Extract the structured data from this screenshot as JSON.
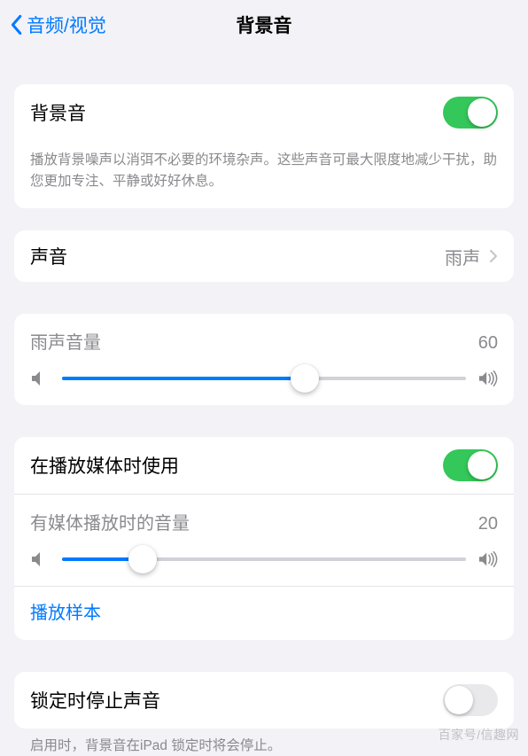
{
  "nav": {
    "back": "音频/视觉",
    "title": "背景音"
  },
  "main": {
    "bg_sound_label": "背景音",
    "bg_sound_on": true,
    "bg_sound_desc": "播放背景噪声以消弭不必要的环境杂声。这些声音可最大限度地减少干扰，助您更加专注、平静或好好休息。"
  },
  "sound": {
    "label": "声音",
    "value": "雨声"
  },
  "volume": {
    "label": "雨声音量",
    "value": "60",
    "percent": 60
  },
  "media": {
    "use_label": "在播放媒体时使用",
    "use_on": true,
    "vol_label": "有媒体播放时的音量",
    "vol_value": "20",
    "vol_percent": 20,
    "sample": "播放样本"
  },
  "lock": {
    "label": "锁定时停止声音",
    "on": false,
    "desc": "启用时，背景音在iPad 锁定时将会停止。"
  },
  "watermark": "百家号/信趣网"
}
